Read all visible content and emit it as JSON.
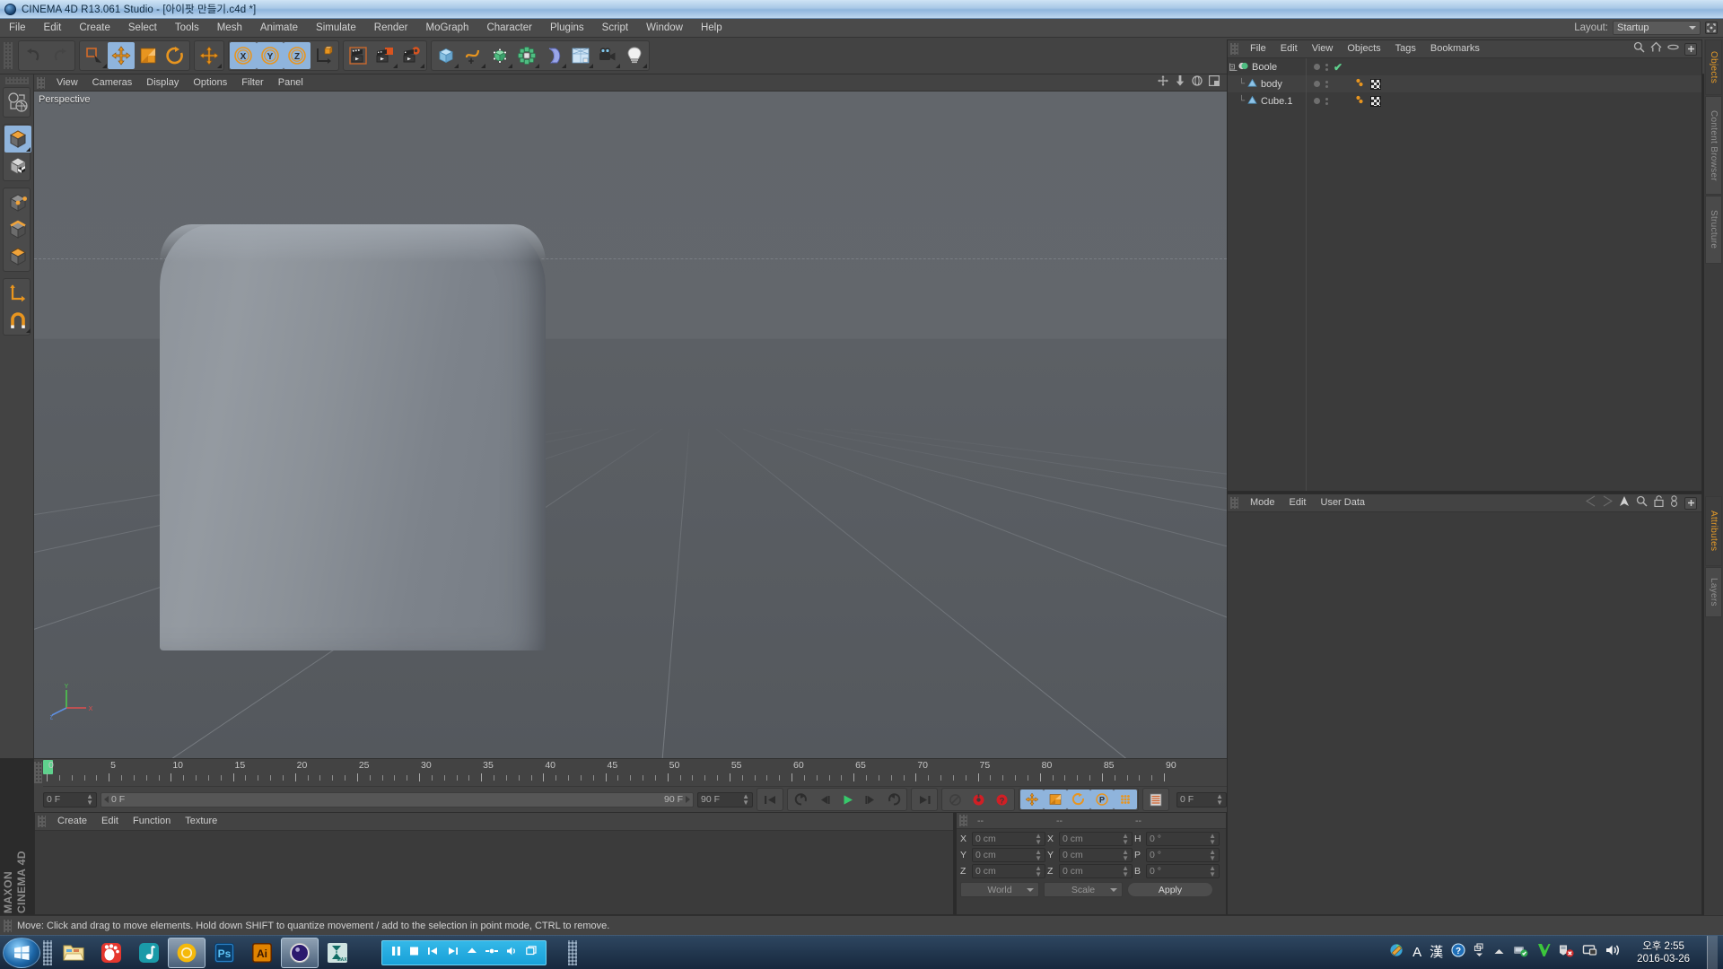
{
  "titlebar": {
    "title": "CINEMA 4D R13.061 Studio - [아이팟 만들기.c4d *]",
    "logo_icon": "c4d-logo-icon"
  },
  "menubar": {
    "items": [
      {
        "label": "File"
      },
      {
        "label": "Edit"
      },
      {
        "label": "Create"
      },
      {
        "label": "Select"
      },
      {
        "label": "Tools"
      },
      {
        "label": "Mesh"
      },
      {
        "label": "Animate"
      },
      {
        "label": "Simulate"
      },
      {
        "label": "Render"
      },
      {
        "label": "MoGraph"
      },
      {
        "label": "Character"
      },
      {
        "label": "Plugins"
      },
      {
        "label": "Script"
      },
      {
        "label": "Window"
      },
      {
        "label": "Help"
      }
    ],
    "layout_label": "Layout:",
    "layout_value": "Startup"
  },
  "toolbar": {
    "groups": [
      {
        "name": "history",
        "buttons": [
          {
            "icon": "undo-icon",
            "selected": false,
            "corner": false
          },
          {
            "icon": "redo-icon",
            "selected": false,
            "corner": false
          }
        ]
      },
      {
        "name": "transform",
        "buttons": [
          {
            "icon": "live-selection-icon",
            "selected": false,
            "corner": true
          },
          {
            "icon": "move-tool-icon",
            "selected": true,
            "corner": false
          },
          {
            "icon": "scale-tool-icon",
            "selected": false,
            "corner": false
          },
          {
            "icon": "rotate-tool-icon",
            "selected": false,
            "corner": false
          }
        ]
      },
      {
        "name": "move-dup",
        "buttons": [
          {
            "icon": "move-plus-icon",
            "selected": false,
            "corner": true
          }
        ]
      },
      {
        "name": "axis-lock",
        "buttons": [
          {
            "icon": "x-axis-icon",
            "selected": true,
            "corner": false
          },
          {
            "icon": "y-axis-icon",
            "selected": true,
            "corner": false
          },
          {
            "icon": "z-axis-icon",
            "selected": true,
            "corner": false
          },
          {
            "icon": "world-coordinate-icon",
            "selected": false,
            "corner": false
          }
        ]
      },
      {
        "name": "render",
        "buttons": [
          {
            "icon": "render-view-icon",
            "selected": false,
            "corner": false
          },
          {
            "icon": "render-picture-viewer-icon",
            "selected": false,
            "corner": true
          },
          {
            "icon": "render-settings-icon",
            "selected": false,
            "corner": true
          }
        ]
      },
      {
        "name": "create",
        "buttons": [
          {
            "icon": "cube-primitive-icon",
            "selected": false,
            "corner": true
          },
          {
            "icon": "spline-pen-icon",
            "selected": false,
            "corner": true
          },
          {
            "icon": "nurbs-generator-icon",
            "selected": false,
            "corner": true
          },
          {
            "icon": "array-modeling-icon",
            "selected": false,
            "corner": true
          },
          {
            "icon": "deformer-bend-icon",
            "selected": false,
            "corner": true
          },
          {
            "icon": "floor-environment-icon",
            "selected": false,
            "corner": true
          },
          {
            "icon": "camera-icon",
            "selected": false,
            "corner": true
          },
          {
            "icon": "light-icon",
            "selected": false,
            "corner": true
          }
        ]
      }
    ]
  },
  "left_tools": {
    "groups": [
      {
        "name": "axis-mode",
        "buttons": [
          {
            "icon": "make-editable-icon",
            "selected": false,
            "corner": false
          }
        ]
      },
      {
        "name": "model-mode",
        "buttons": [
          {
            "icon": "model-mode-icon",
            "selected": true,
            "corner": true
          },
          {
            "icon": "texture-mode-icon",
            "selected": false,
            "corner": false
          }
        ]
      },
      {
        "name": "component-mode",
        "buttons": [
          {
            "icon": "points-mode-icon",
            "selected": false,
            "corner": false
          },
          {
            "icon": "edges-mode-icon",
            "selected": false,
            "corner": false
          },
          {
            "icon": "polygons-mode-icon",
            "selected": false,
            "corner": false
          }
        ]
      },
      {
        "name": "snap",
        "buttons": [
          {
            "icon": "workplane-axis-icon",
            "selected": false,
            "corner": false
          },
          {
            "icon": "snap-magnet-icon",
            "selected": false,
            "corner": true
          }
        ]
      }
    ]
  },
  "viewport": {
    "menu": [
      {
        "label": "View"
      },
      {
        "label": "Cameras"
      },
      {
        "label": "Display"
      },
      {
        "label": "Options"
      },
      {
        "label": "Filter"
      },
      {
        "label": "Panel"
      }
    ],
    "label": "Perspective",
    "header_icons": [
      "pan-view-icon",
      "dolly-view-icon",
      "rotate-view-icon",
      "maximize-view-icon"
    ],
    "axis_labels": {
      "x": "X",
      "y": "Y",
      "z": "Z"
    }
  },
  "object_manager": {
    "menu": [
      {
        "label": "File"
      },
      {
        "label": "Edit"
      },
      {
        "label": "View"
      },
      {
        "label": "Objects"
      },
      {
        "label": "Tags"
      },
      {
        "label": "Bookmarks"
      }
    ],
    "header_icons": [
      "search-icon",
      "home-icon",
      "eye-icon",
      "add-panel-icon"
    ],
    "objects": [
      {
        "name": "Boole",
        "depth": 0,
        "icon": "boole-object-icon",
        "expander": "collapse-icon",
        "check": true,
        "tags": []
      },
      {
        "name": "body",
        "depth": 1,
        "icon": "polygon-object-icon",
        "check": false,
        "tags": [
          "material-checker-tag"
        ]
      },
      {
        "name": "Cube.1",
        "depth": 1,
        "icon": "polygon-object-icon",
        "check": false,
        "tags": [
          "material-checker-tag"
        ]
      }
    ]
  },
  "attributes": {
    "menu": [
      {
        "label": "Mode"
      },
      {
        "label": "Edit"
      },
      {
        "label": "User Data"
      }
    ],
    "header_icons": [
      "nav-back-forward-icon",
      "pin-arrow-icon",
      "search-icon",
      "lock-icon",
      "link-icon",
      "add-panel-icon"
    ]
  },
  "dock_tabs": {
    "top": [
      {
        "label": "Objects",
        "active": true
      },
      {
        "label": "Content Browser",
        "active": false
      },
      {
        "label": "Structure",
        "active": false
      }
    ],
    "bottom": [
      {
        "label": "Attributes",
        "active": true
      },
      {
        "label": "Layers",
        "active": false
      }
    ]
  },
  "timeline": {
    "ticks": [
      0,
      5,
      10,
      15,
      20,
      25,
      30,
      35,
      40,
      45,
      50,
      55,
      60,
      65,
      70,
      75,
      80,
      85,
      90
    ],
    "range_start": 0,
    "range_end": 90,
    "current_frame_label": "0 F",
    "range_start_label": "0 F",
    "range_end_label": "90 F",
    "preview_end_label": "90 F",
    "right_frame_label": "0 F",
    "playhead_frame": 0,
    "transport": [
      {
        "icon": "go-to-start-icon",
        "selected": false
      },
      {
        "icon": "previous-key-icon",
        "selected": false
      },
      {
        "icon": "step-back-icon",
        "selected": false
      },
      {
        "icon": "play-icon",
        "selected": false
      },
      {
        "icon": "step-forward-icon",
        "selected": false
      },
      {
        "icon": "next-key-icon",
        "selected": false
      },
      {
        "icon": "go-to-end-icon",
        "selected": false
      }
    ],
    "record_group": [
      {
        "icon": "autokey-icon",
        "selected": false
      },
      {
        "icon": "record-active-objects-icon",
        "selected": false
      },
      {
        "icon": "keyframe-selection-icon",
        "selected": false
      }
    ],
    "key_toggles": [
      {
        "icon": "position-key-icon",
        "selected": true
      },
      {
        "icon": "scale-key-icon",
        "selected": true
      },
      {
        "icon": "rotation-key-icon",
        "selected": true
      },
      {
        "icon": "param-key-icon",
        "selected": true
      },
      {
        "icon": "point-level-anim-icon",
        "selected": true
      }
    ],
    "extra": [
      {
        "icon": "timeline-settings-icon",
        "selected": false
      }
    ]
  },
  "material_manager": {
    "menu": [
      {
        "label": "Create"
      },
      {
        "label": "Edit"
      },
      {
        "label": "Function"
      },
      {
        "label": "Texture"
      }
    ]
  },
  "coordinates": {
    "col_headers": [
      "--",
      "--",
      "--"
    ],
    "rows": [
      {
        "label_pos": "X",
        "value_pos": "0 cm",
        "label_size": "X",
        "value_size": "0 cm",
        "label_rot": "H",
        "value_rot": "0 °"
      },
      {
        "label_pos": "Y",
        "value_pos": "0 cm",
        "label_size": "Y",
        "value_size": "0 cm",
        "label_rot": "P",
        "value_rot": "0 °"
      },
      {
        "label_pos": "Z",
        "value_pos": "0 cm",
        "label_size": "Z",
        "value_size": "0 cm",
        "label_rot": "B",
        "value_rot": "0 °"
      }
    ],
    "system_select": "World",
    "mode_select": "Scale",
    "apply_label": "Apply"
  },
  "statusbar": {
    "message": "Move: Click and drag to move elements. Hold down SHIFT to quantize movement / add to the selection in point mode, CTRL to remove."
  },
  "branding": {
    "maxon": "MAXON",
    "product": "CINEMA 4D"
  },
  "taskbar": {
    "start_icon": "windows-start-icon",
    "apps": [
      {
        "icon": "file-explorer-icon",
        "label": "File Explorer",
        "active": false
      },
      {
        "icon": "gom-player-icon",
        "label": "GOM Player",
        "active": false
      },
      {
        "icon": "music-player-icon",
        "label": "Music Player",
        "active": false
      },
      {
        "icon": "chromium-icon",
        "label": "Chromium",
        "active": true
      },
      {
        "icon": "photoshop-icon",
        "label": "Ps",
        "active": false
      },
      {
        "icon": "illustrator-icon",
        "label": "Ai",
        "active": false
      },
      {
        "icon": "cinema4d-icon",
        "label": "CINEMA 4D",
        "active": true
      },
      {
        "icon": "3dsmax-icon",
        "label": "3ds Max",
        "active": false
      }
    ],
    "media_controls": [
      "pause-icon",
      "stop-icon",
      "previous-track-icon",
      "next-track-icon",
      "eject-icon",
      "mute-icon",
      "volume-icon",
      "fullscreen-icon"
    ],
    "tray_icons": [
      "paint-tray-icon",
      "ime-alpha-icon",
      "ime-hanja-icon",
      "help-tray-icon",
      "show-hidden-icon",
      "up-arrow-icon",
      "network-ok-icon",
      "vlc-icon",
      "security-alert-icon",
      "display-icon",
      "volume-speaker-icon"
    ],
    "clock_time": "오후 2:55",
    "clock_date": "2016-03-26"
  },
  "colors": {
    "accent_blue": "#8fb4dc",
    "orange": "#e8951f",
    "green": "#5fd18d",
    "panel_bg": "#434343",
    "dock_active": "#e49a28"
  }
}
